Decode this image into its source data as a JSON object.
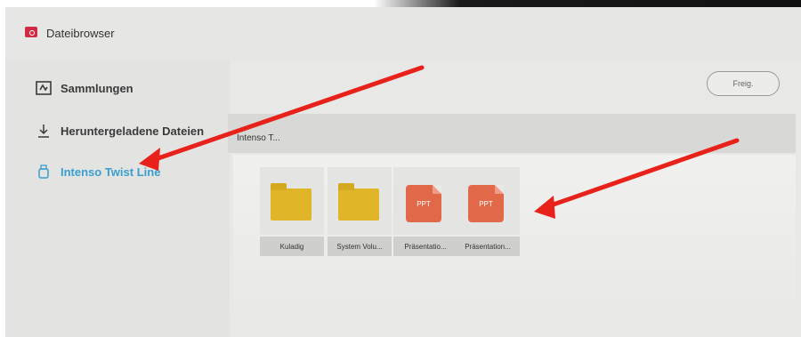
{
  "app": {
    "title": "Dateibrowser",
    "icon": "file-browser-icon"
  },
  "sidebar": {
    "items": [
      {
        "label": "Sammlungen",
        "icon": "collections-icon",
        "active": false
      },
      {
        "label": "Heruntergeladene Dateien",
        "icon": "download-icon",
        "active": false
      },
      {
        "label": "Intenso Twist Line",
        "icon": "usb-drive-icon",
        "active": true
      }
    ]
  },
  "toolbar": {
    "share_label": "Freig."
  },
  "breadcrumb": "Intenso T...",
  "files": [
    {
      "name": "Kuladig",
      "type": "folder"
    },
    {
      "name": "System Volu...",
      "type": "folder"
    },
    {
      "name": "Präsentatio...",
      "type": "ppt",
      "badge": "PPT"
    },
    {
      "name": "Präsentation...",
      "type": "ppt",
      "badge": "PPT"
    }
  ],
  "colors": {
    "accent": "#3a9fcf",
    "arrow": "#e8211b",
    "folder": "#e0b628",
    "ppt": "#e2684a"
  }
}
